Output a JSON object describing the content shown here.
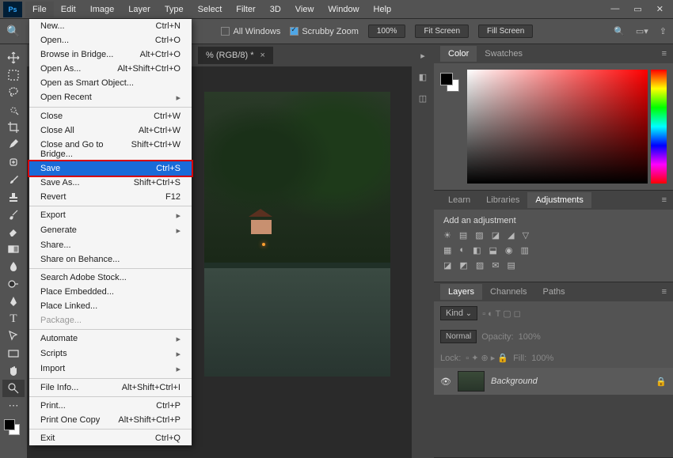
{
  "menubar": {
    "items": [
      "File",
      "Edit",
      "Image",
      "Layer",
      "Type",
      "Select",
      "Filter",
      "3D",
      "View",
      "Window",
      "Help"
    ]
  },
  "toolbar": {
    "winlabel": "All Windows",
    "scrubby": "Scrubby Zoom",
    "zoom": "100%",
    "fit": "Fit Screen",
    "fill": "Fill Screen"
  },
  "doc": {
    "tab": "% (RGB/8) *"
  },
  "file_menu": [
    {
      "l": "New...",
      "s": "Ctrl+N"
    },
    {
      "l": "Open...",
      "s": "Ctrl+O"
    },
    {
      "l": "Browse in Bridge...",
      "s": "Alt+Ctrl+O"
    },
    {
      "l": "Open As...",
      "s": "Alt+Shift+Ctrl+O"
    },
    {
      "l": "Open as Smart Object...",
      "s": ""
    },
    {
      "l": "Open Recent",
      "s": "",
      "sub": true
    },
    {
      "sep": true
    },
    {
      "l": "Close",
      "s": "Ctrl+W"
    },
    {
      "l": "Close All",
      "s": "Alt+Ctrl+W"
    },
    {
      "l": "Close and Go to Bridge...",
      "s": "Shift+Ctrl+W"
    },
    {
      "l": "Save",
      "s": "Ctrl+S",
      "hl": true
    },
    {
      "l": "Save As...",
      "s": "Shift+Ctrl+S"
    },
    {
      "l": "Revert",
      "s": "F12"
    },
    {
      "sep": true
    },
    {
      "l": "Export",
      "s": "",
      "sub": true
    },
    {
      "l": "Generate",
      "s": "",
      "sub": true
    },
    {
      "l": "Share...",
      "s": ""
    },
    {
      "l": "Share on Behance...",
      "s": ""
    },
    {
      "sep": true
    },
    {
      "l": "Search Adobe Stock...",
      "s": ""
    },
    {
      "l": "Place Embedded...",
      "s": ""
    },
    {
      "l": "Place Linked...",
      "s": ""
    },
    {
      "l": "Package...",
      "s": "",
      "disabled": true
    },
    {
      "sep": true
    },
    {
      "l": "Automate",
      "s": "",
      "sub": true
    },
    {
      "l": "Scripts",
      "s": "",
      "sub": true
    },
    {
      "l": "Import",
      "s": "",
      "sub": true
    },
    {
      "sep": true
    },
    {
      "l": "File Info...",
      "s": "Alt+Shift+Ctrl+I"
    },
    {
      "sep": true
    },
    {
      "l": "Print...",
      "s": "Ctrl+P"
    },
    {
      "l": "Print One Copy",
      "s": "Alt+Shift+Ctrl+P"
    },
    {
      "sep": true
    },
    {
      "l": "Exit",
      "s": "Ctrl+Q"
    }
  ],
  "panels": {
    "color_tab": "Color",
    "swatches_tab": "Swatches",
    "learn_tab": "Learn",
    "libraries_tab": "Libraries",
    "adjustments_tab": "Adjustments",
    "add_adj": "Add an adjustment",
    "layers_tab": "Layers",
    "channels_tab": "Channels",
    "paths_tab": "Paths",
    "kind": "Kind",
    "blend": "Normal",
    "opacity_label": "Opacity:",
    "opacity": "100%",
    "lock_label": "Lock:",
    "fill_label": "Fill:",
    "fill": "100%",
    "layer_name": "Background"
  }
}
